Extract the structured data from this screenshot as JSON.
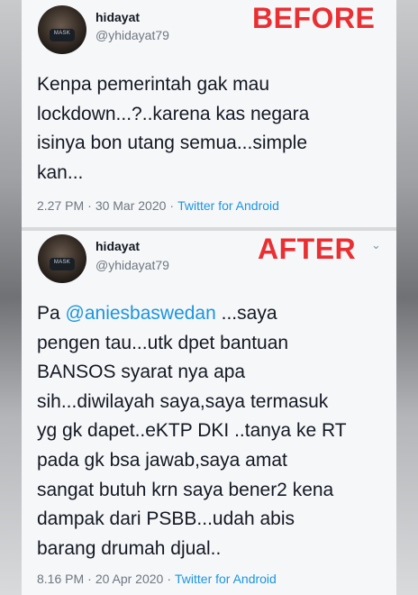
{
  "tweets": [
    {
      "label": "BEFORE",
      "display_name": "hidayat",
      "handle": "@yhidayat79",
      "avatar_text": "MASK",
      "lines": [
        "Kenpa pemerintah gak mau",
        "lockdown...?..karena kas negara",
        "isinya bon utang semua...simple",
        "kan..."
      ],
      "time": "2.27 PM",
      "separator": "·",
      "date": "30 Mar 2020",
      "source": "Twitter for Android"
    },
    {
      "label": "AFTER",
      "display_name": "hidayat",
      "handle": "@yhidayat79",
      "avatar_text": "MASK",
      "menu_glyph": "⌄",
      "line1_prefix": "Pa ",
      "mention": "@aniesbaswedan",
      "line1_suffix": " ...saya",
      "lines": [
        "pengen tau...utk dpet bantuan",
        "BANSOS syarat nya apa",
        "sih...diwilayah saya,saya termasuk",
        "yg gk dapet..eKTP DKI ..tanya ke RT",
        "pada gk bsa jawab,saya amat",
        "sangat butuh krn saya bener2 kena",
        "dampak dari PSBB...udah abis",
        "barang drumah djual.."
      ],
      "time": "8.16 PM",
      "separator": "·",
      "date": "20 Apr 2020",
      "source": "Twitter for Android"
    }
  ],
  "colors": {
    "stamp": "#ea2f33",
    "link": "#1b95e0",
    "text": "#141823",
    "muted": "#6e7781"
  }
}
